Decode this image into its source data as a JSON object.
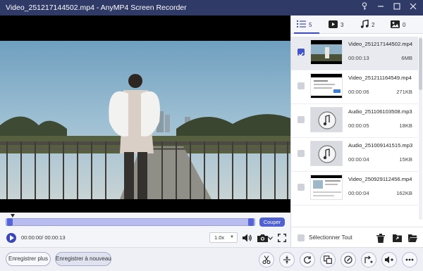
{
  "window": {
    "title": "Video_251217144502.mp4  -  AnyMP4 Screen Recorder",
    "icons": [
      "key-icon",
      "minimize-icon",
      "maximize-icon",
      "close-icon"
    ]
  },
  "tabs": [
    {
      "icon": "list-icon",
      "count": "5"
    },
    {
      "icon": "video-icon",
      "count": "3"
    },
    {
      "icon": "audio-icon",
      "count": "2"
    },
    {
      "icon": "image-icon",
      "count": "0"
    }
  ],
  "files": [
    {
      "name": "Video_251217144502.mp4",
      "duration": "00:00:13",
      "size": "6MB",
      "kind": "video",
      "selected": true
    },
    {
      "name": "Video_251211164549.mp4",
      "duration": "00:00:06",
      "size": "271KB",
      "kind": "video",
      "selected": false
    },
    {
      "name": "Audio_251106103508.mp3",
      "duration": "00:00:05",
      "size": "18KB",
      "kind": "audio",
      "selected": false
    },
    {
      "name": "Audio_251009141515.mp3",
      "duration": "00:00:04",
      "size": "15KB",
      "kind": "audio",
      "selected": false
    },
    {
      "name": "Video_250929112456.mp4",
      "duration": "00:00:04",
      "size": "162KB",
      "kind": "video",
      "selected": false
    }
  ],
  "panel_footer": {
    "select_all_label": "Sélectionner Tout",
    "icons": [
      "trash-icon",
      "folder-export-icon",
      "folder-open-icon"
    ]
  },
  "player": {
    "couper_label": "Couper",
    "time_text": "00:00:00/ 00:00:13",
    "speed": "1.0x",
    "progress": 0.0
  },
  "bottom": {
    "record_more_label": "Enregistrer plus",
    "record_again_label": "Enregistrer à nouveau",
    "tools": [
      "cut-icon",
      "merge-icon",
      "rotate-icon",
      "compress-icon",
      "edit-metadata-icon",
      "convert-icon",
      "volume-icon",
      "more-icon"
    ]
  },
  "colors": {
    "accent": "#3d4cc0",
    "titlebar": "#2f3a66"
  }
}
